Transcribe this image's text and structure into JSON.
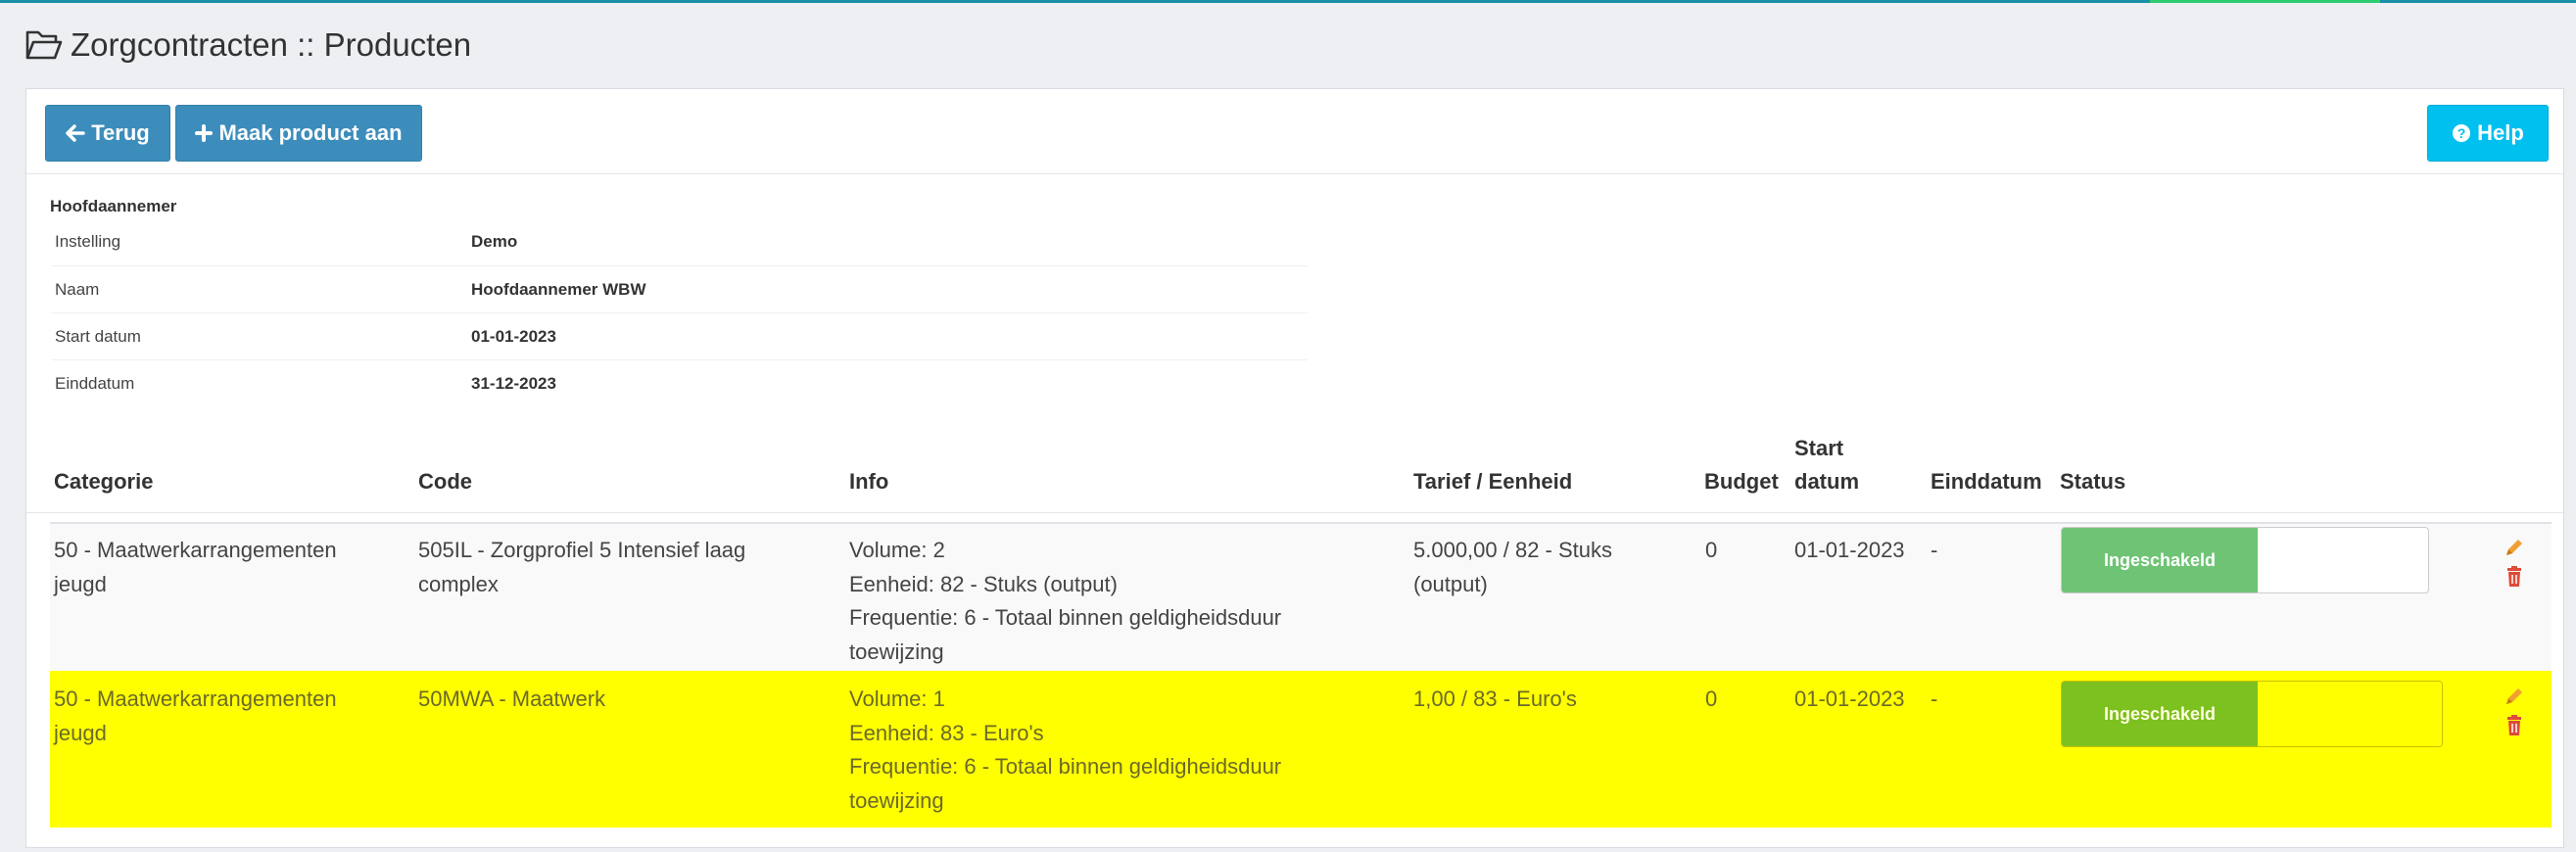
{
  "page": {
    "title": "Zorgcontracten :: Producten"
  },
  "toolbar": {
    "back_label": "Terug",
    "add_label": "Maak product aan",
    "help_label": "Help"
  },
  "contractor": {
    "heading": "Hoofdaannemer",
    "fields": [
      {
        "label": "Instelling",
        "value": "Demo"
      },
      {
        "label": "Naam",
        "value": "Hoofdaannemer WBW"
      },
      {
        "label": "Start datum",
        "value": "01-01-2023"
      },
      {
        "label": "Einddatum",
        "value": "31-12-2023"
      }
    ]
  },
  "table": {
    "columns": {
      "categorie": "Categorie",
      "code": "Code",
      "info": "Info",
      "tarief": "Tarief / Eenheid",
      "budget": "Budget",
      "start_line1": "Start",
      "start_line2": "datum",
      "einddatum": "Einddatum",
      "status": "Status"
    },
    "rows": [
      {
        "categorie_l1": "50 - Maatwerkarrangementen",
        "categorie_l2": "jeugd",
        "code_l1": "505IL - Zorgprofiel 5 Intensief laag",
        "code_l2": "complex",
        "info_volume": "Volume: 2",
        "info_eenheid": "Eenheid: 82 - Stuks (output)",
        "info_freq": "Frequentie: 6 - Totaal binnen geldigheidsduur",
        "info_freq2": "toewijzing",
        "tarief_l1": "5.000,00 / 82 - Stuks",
        "tarief_l2": "(output)",
        "budget": "0",
        "start": "01-01-2023",
        "einddatum": "-",
        "status": "Ingeschakeld"
      },
      {
        "categorie_l1": "50 - Maatwerkarrangementen",
        "categorie_l2": "jeugd",
        "code_l1": "50MWA - Maatwerk",
        "code_l2": "",
        "info_volume": "Volume: 1",
        "info_eenheid": "Eenheid: 83 - Euro's",
        "info_freq": "Frequentie: 6 - Totaal binnen geldigheidsduur",
        "info_freq2": "toewijzing",
        "tarief_l1": "1,00 / 83 - Euro's",
        "tarief_l2": "",
        "budget": "0",
        "start": "01-01-2023",
        "einddatum": "-",
        "status": "Ingeschakeld"
      }
    ]
  },
  "colors": {
    "primary_button": "#3c8dbc",
    "help_button": "#00c0ef",
    "row_highlight": "#ffff00",
    "status_on": "#6ec474",
    "edit_icon": "#f0a030",
    "delete_icon": "#dd4b39"
  },
  "icons": {
    "title": "folder-open-icon",
    "back": "arrow-left-icon",
    "add": "plus-icon",
    "help": "question-circle-icon",
    "edit": "pencil-icon",
    "delete": "trash-icon"
  }
}
